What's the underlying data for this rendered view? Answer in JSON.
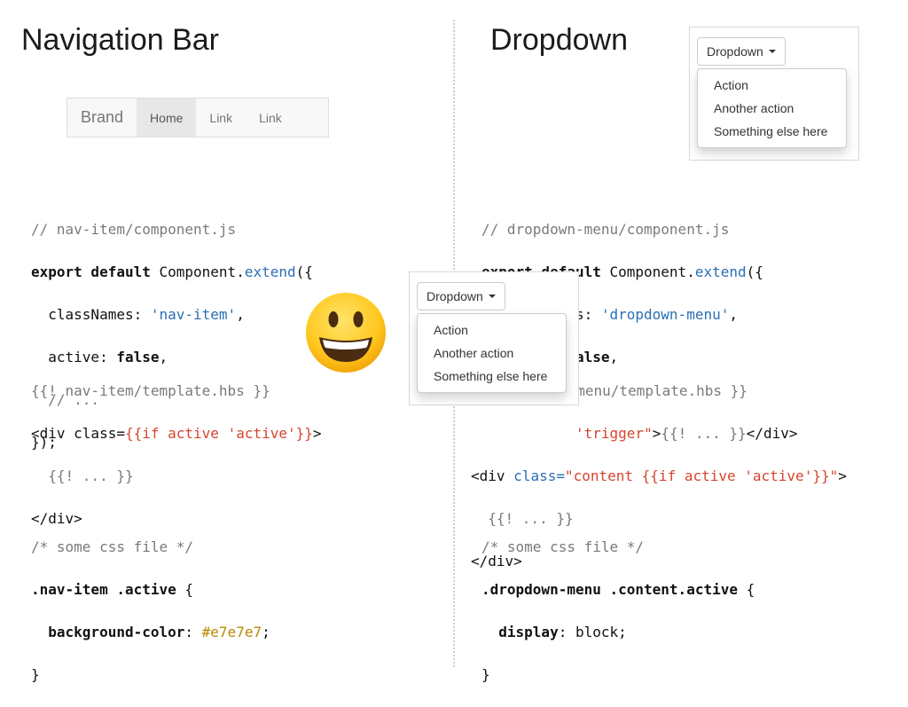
{
  "left": {
    "title": "Navigation Bar",
    "navbar": {
      "brand": "Brand",
      "links": [
        "Home",
        "Link",
        "Link"
      ],
      "active_index": 0,
      "active_color": "#e7e7e7"
    },
    "js_code": [
      "// nav-item/component.js",
      "export default Component.extend({",
      "  classNames: 'nav-item',",
      "  active: false,",
      "  // ...",
      "});"
    ],
    "hbs_code": [
      "{{! nav-item/template.hbs }}",
      "<div class={{if active 'active'}}>",
      "  {{! ... }}",
      "</div>"
    ],
    "css_code": [
      "/* some css file */",
      ".nav-item .active {",
      "  background-color: #e7e7e7;",
      "}"
    ]
  },
  "right": {
    "title": "Dropdown",
    "dropdown": {
      "button_label": "Dropdown",
      "items": [
        "Action",
        "Another action",
        "Something else here"
      ]
    },
    "js_code": [
      "// dropdown-menu/component.js",
      "export default Component.extend({",
      "  classNames: 'dropdown-menu',",
      "  active: false,"
    ],
    "hbs_code_visible": [
      "n-menu/template.hbs }}",
      "'trigger\">{{! ... }}</div>",
      "<div class=\"content {{if active 'active'}}\">",
      "  {{! ... }}",
      "</div>"
    ],
    "css_code": [
      "/* some css file */",
      ".dropdown-menu .content.active {",
      "  display: block;",
      "}"
    ]
  },
  "emoji": {
    "name": "grinning-face-icon"
  }
}
